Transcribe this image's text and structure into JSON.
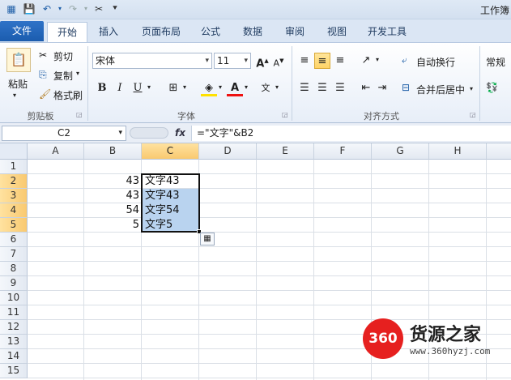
{
  "window": {
    "title": "工作簿"
  },
  "qat": {
    "save_icon": "save-icon",
    "undo_icon": "undo-icon",
    "redo_icon": "redo-icon",
    "tool_icon": "format-painter-icon"
  },
  "tabs": [
    {
      "label": "文件"
    },
    {
      "label": "开始"
    },
    {
      "label": "插入"
    },
    {
      "label": "页面布局"
    },
    {
      "label": "公式"
    },
    {
      "label": "数据"
    },
    {
      "label": "审阅"
    },
    {
      "label": "视图"
    },
    {
      "label": "开发工具"
    }
  ],
  "clipboard": {
    "paste": "粘贴",
    "cut": "剪切",
    "copy": "复制",
    "format_painter": "格式刷",
    "group": "剪贴板"
  },
  "font": {
    "name": "宋体",
    "size": "11",
    "group": "字体",
    "bold": "B",
    "italic": "I",
    "underline": "U"
  },
  "alignment": {
    "wrap": "自动换行",
    "merge": "合并后居中",
    "group": "对齐方式"
  },
  "number": {
    "format": "常规"
  },
  "formula_bar": {
    "name_box": "C2",
    "fx": "fx",
    "formula": "=\"文字\"&B2"
  },
  "columns": [
    "A",
    "B",
    "C",
    "D",
    "E",
    "F",
    "G",
    "H"
  ],
  "rows": [
    "1",
    "2",
    "3",
    "4",
    "5",
    "6",
    "7",
    "8",
    "9",
    "10",
    "11",
    "12",
    "13",
    "14",
    "15"
  ],
  "cells": {
    "b": [
      "43",
      "43",
      "54",
      "5"
    ],
    "c": [
      "文字43",
      "文字43",
      "文字54",
      "文字5"
    ]
  },
  "watermark": {
    "badge": "360",
    "name": "货源之家",
    "url": "www.360hyzj.com"
  },
  "colors": {
    "accent": "#1b5cae",
    "selection": "#b9d3ef",
    "header_selected": "#f9c970",
    "watermark_red": "#e6201f"
  }
}
